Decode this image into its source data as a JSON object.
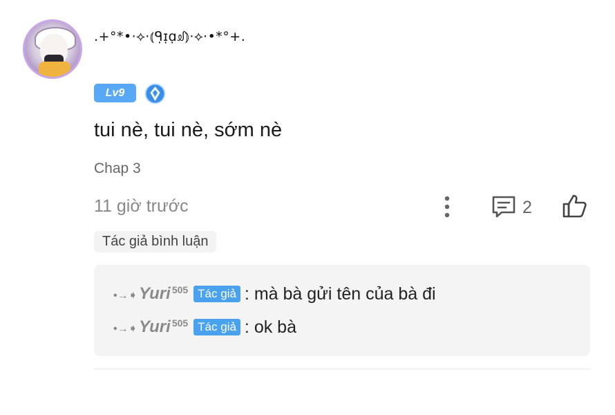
{
  "comment": {
    "username": ".+°*•·⟡·⦅ᑫ̣ɪ̣ɑ̣ᦾ⦆·⟡·•*°+.",
    "level_badge": "Lv9",
    "rank_icon": "diamond-rank-icon",
    "text": "tui nè, tui nè, sớm nè",
    "chapter": "Chap 3",
    "time": "11 giờ trước",
    "reply_count": "2",
    "author_tag": "Tác giả bình luận"
  },
  "replies": [
    {
      "decoration": "•→➧",
      "name": "Yuri",
      "superscript": "505",
      "badge": "Tác giả",
      "text": ": mà bà gửi tên của bà đi"
    },
    {
      "decoration": "•→➧",
      "name": "Yuri",
      "superscript": "505",
      "badge": "Tác giả",
      "text": ": ok bà"
    }
  ],
  "colors": {
    "level_badge": "#58a8f5",
    "author_badge": "#4aa2ee",
    "reply_box": "#f4f4f4"
  }
}
